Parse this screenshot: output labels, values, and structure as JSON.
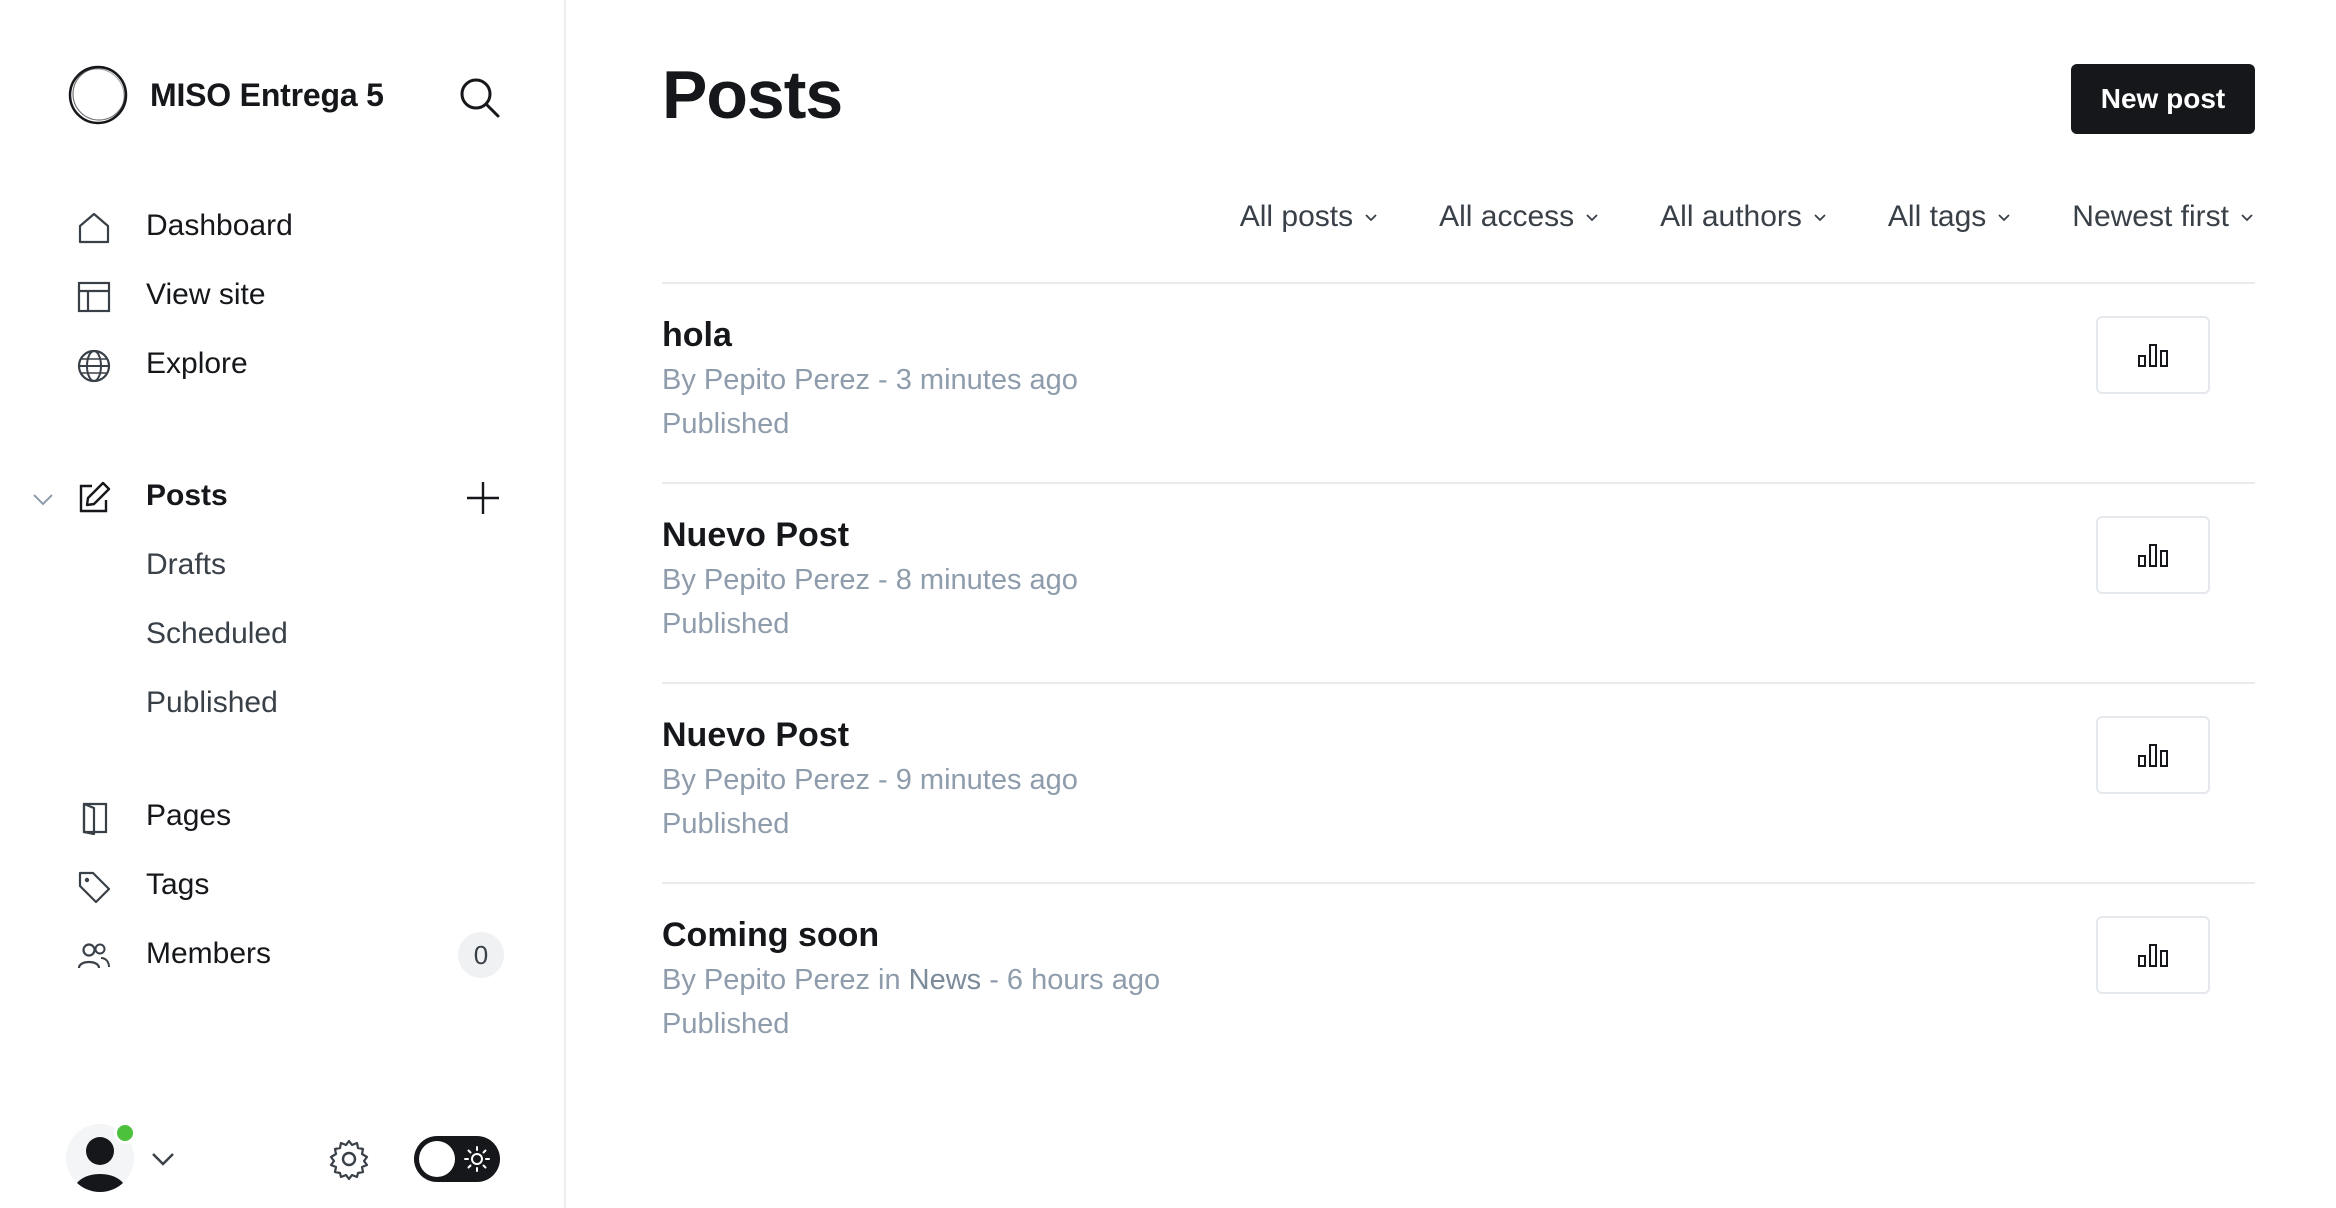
{
  "sidebar": {
    "brand": {
      "title": "MISO Entrega 5"
    },
    "nav": [
      {
        "label": "Dashboard",
        "icon": "home-icon"
      },
      {
        "label": "View site",
        "icon": "layout-icon"
      },
      {
        "label": "Explore",
        "icon": "globe-icon"
      }
    ],
    "posts": {
      "label": "Posts",
      "icon": "pencil-edit-icon"
    },
    "posts_sub": [
      {
        "label": "Drafts"
      },
      {
        "label": "Scheduled"
      },
      {
        "label": "Published"
      }
    ],
    "nav2": [
      {
        "label": "Pages",
        "icon": "page-icon"
      },
      {
        "label": "Tags",
        "icon": "tag-icon"
      },
      {
        "label": "Members",
        "icon": "members-icon",
        "count": "0"
      }
    ]
  },
  "main": {
    "title": "Posts",
    "new_post_label": "New post",
    "filters": [
      {
        "label": "All posts"
      },
      {
        "label": "All access"
      },
      {
        "label": "All authors"
      },
      {
        "label": "All tags"
      },
      {
        "label": "Newest first"
      }
    ],
    "posts": [
      {
        "title": "hola",
        "by": "By Pepito Perez",
        "in": "",
        "tag": "",
        "time": " - 3 minutes ago",
        "status": "Published"
      },
      {
        "title": "Nuevo Post",
        "by": "By Pepito Perez",
        "in": "",
        "tag": "",
        "time": " - 8 minutes ago",
        "status": "Published"
      },
      {
        "title": "Nuevo Post",
        "by": "By Pepito Perez",
        "in": "",
        "tag": "",
        "time": " - 9 minutes ago",
        "status": "Published"
      },
      {
        "title": "Coming soon",
        "by": "By Pepito Perez",
        "in": " in ",
        "tag": "News",
        "time": " - 6 hours ago",
        "status": "Published"
      }
    ]
  },
  "colors": {
    "accent": "#15171a",
    "muted_text": "#8e9cac",
    "online": "#4cc13c",
    "divider": "#e9ecee"
  }
}
